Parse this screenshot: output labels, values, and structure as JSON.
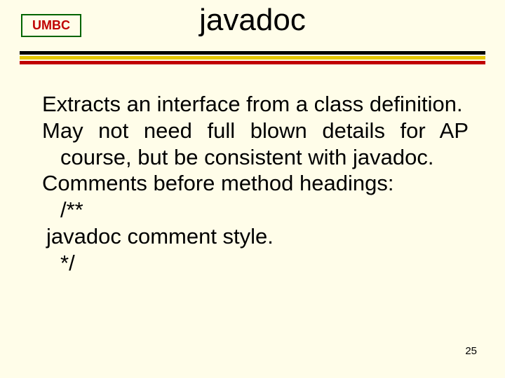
{
  "header": {
    "badge": "UMBC",
    "title": "javadoc"
  },
  "body": {
    "paragraphs": [
      "Extracts an interface from a class definition.",
      "May not need full blown details for AP course, but be consistent with javadoc.",
      "Comments before method headings:"
    ],
    "code": [
      "/**",
      " javadoc comment style.",
      "*/"
    ]
  },
  "footer": {
    "page": "25"
  }
}
